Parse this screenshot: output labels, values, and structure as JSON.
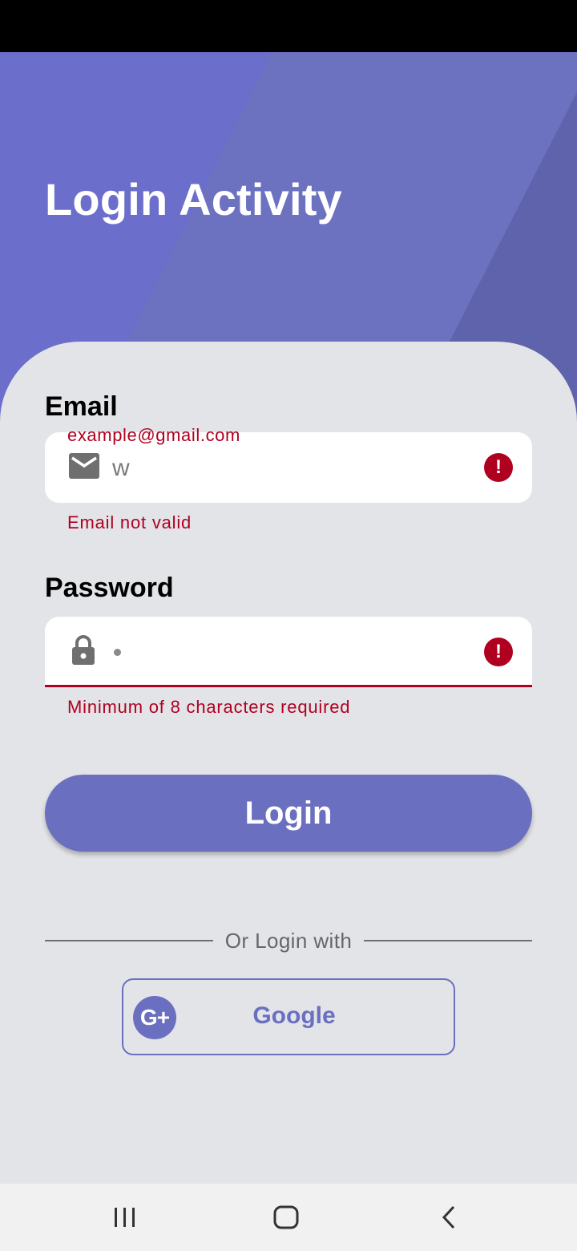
{
  "header": {
    "title": "Login Activity"
  },
  "email": {
    "label": "Email",
    "floating_hint": "example@gmail.com",
    "value": "w",
    "error": "Email not valid",
    "icon": "mail-icon",
    "error_icon": "error-icon"
  },
  "password": {
    "label": "Password",
    "value_masked": "•",
    "error": "Minimum of 8 characters required",
    "icon": "lock-icon",
    "error_icon": "error-icon"
  },
  "login_button": {
    "label": "Login"
  },
  "divider": {
    "text": "Or Login with"
  },
  "google_button": {
    "label": "Google",
    "icon_text": "G+"
  },
  "colors": {
    "primary": "#6b6fc0",
    "error": "#b00020",
    "background": "#e3e4e8"
  },
  "nav": {
    "recents_icon": "recents-icon",
    "home_icon": "home-icon",
    "back_icon": "back-icon"
  }
}
